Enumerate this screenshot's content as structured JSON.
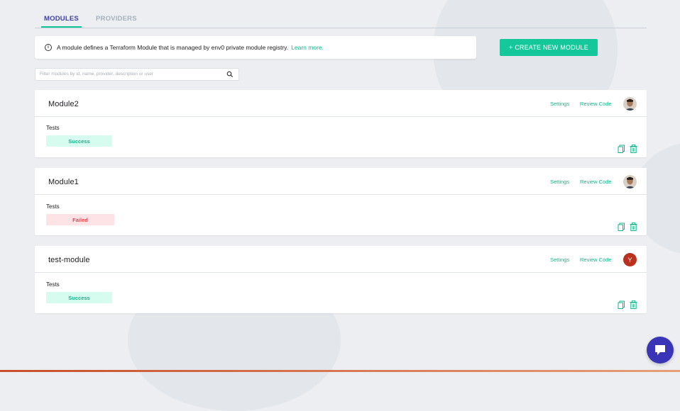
{
  "tabs": [
    {
      "label": "MODULES",
      "active": true
    },
    {
      "label": "PROVIDERS",
      "active": false
    }
  ],
  "info_banner": {
    "icon": "info-circle-icon",
    "text": "A module defines a Terraform Module that is managed by env0 private module registry.",
    "link": "Learn more."
  },
  "create_button": {
    "label": "+ CREATE NEW MODULE"
  },
  "filter": {
    "placeholder": "Filter modules by id, name, provider, description or user",
    "value": ""
  },
  "modules": [
    {
      "name": "Module2",
      "settings": "Settings",
      "review": "Review Code",
      "tests_label": "Tests",
      "status": "Success",
      "avatar": "photo"
    },
    {
      "name": "Module1",
      "settings": "Settings",
      "review": "Review Code",
      "tests_label": "Tests",
      "status": "Failed",
      "avatar": "photo"
    },
    {
      "name": "test-module",
      "settings": "Settings",
      "review": "Review Code",
      "tests_label": "Tests",
      "status": "Success",
      "avatar": "Y"
    }
  ],
  "colors": {
    "accent": "#14c89b",
    "tab_active": "#3f3fa8",
    "success_bg": "#d6fbef",
    "failed_bg": "#fde3e6",
    "failed_text": "#e5454f",
    "chat": "#3a35b6"
  },
  "chat_icon": "chat-bubble-icon"
}
